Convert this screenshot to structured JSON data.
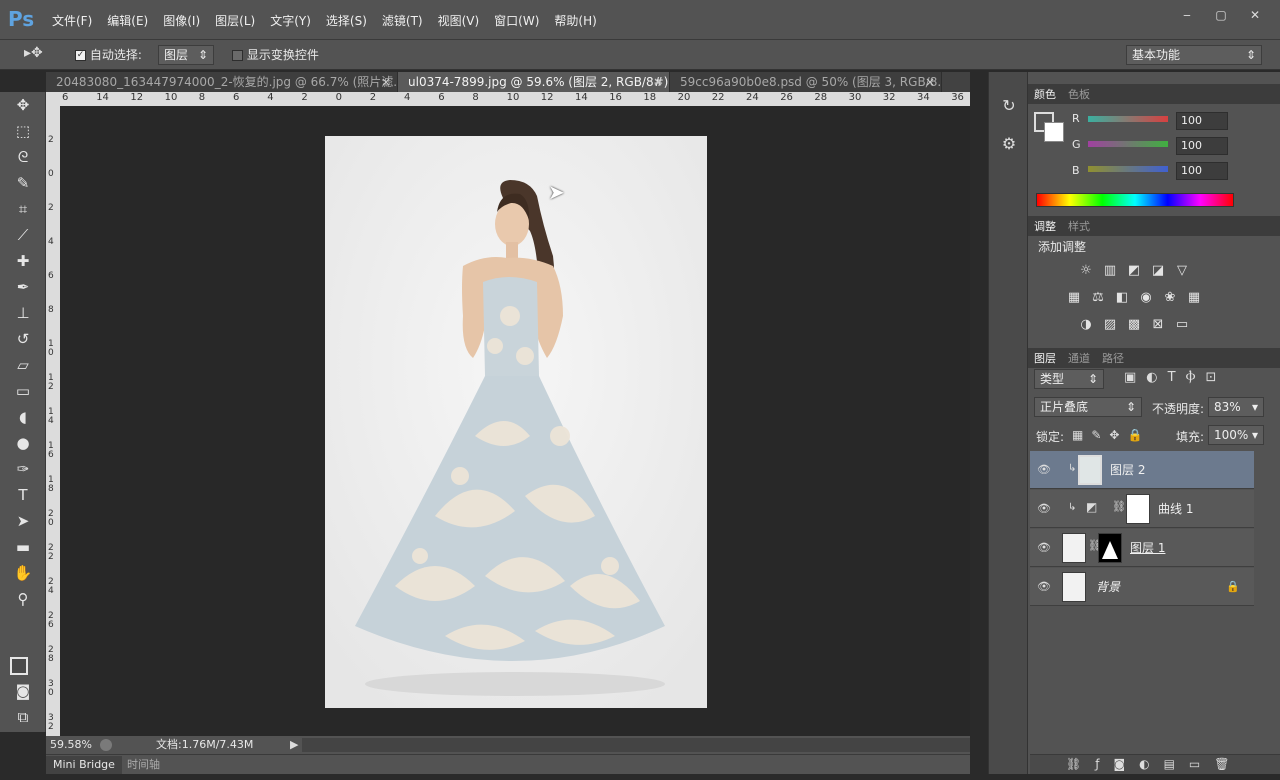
{
  "app": {
    "logo": "Ps",
    "menu": [
      "文件(F)",
      "编辑(E)",
      "图像(I)",
      "图层(L)",
      "文字(Y)",
      "选择(S)",
      "滤镜(T)",
      "视图(V)",
      "窗口(W)",
      "帮助(H)"
    ],
    "window_controls": [
      "‒",
      "▢",
      "✕"
    ]
  },
  "options": {
    "move_icon": "move-tool-icon",
    "auto_select_label": "自动选择:",
    "auto_select_checked": true,
    "auto_select_target": "图层",
    "show_transform_label": "显示变换控件",
    "show_transform_checked": false,
    "workspace": "基本功能"
  },
  "tabs": [
    {
      "label": "20483080_163447974000_2-恢复的.jpg @ 66.7% (照片滤...",
      "active": false
    },
    {
      "label": "ul0374-7899.jpg @ 59.6% (图层 2, RGB/8#) *",
      "active": true
    },
    {
      "label": "59cc96a90b0e8.psd @ 50% (图层 3, RGB/8...",
      "active": false
    }
  ],
  "ruler": {
    "top_labels": [
      "6",
      "14",
      "12",
      "10",
      "8",
      "6",
      "4",
      "2",
      "0",
      "2",
      "4",
      "6",
      "8",
      "10",
      "12",
      "14",
      "16",
      "18",
      "20",
      "22",
      "24",
      "26",
      "28",
      "30",
      "32",
      "34",
      "36"
    ],
    "left_labels": [
      "2",
      "0",
      "2",
      "4",
      "6",
      "8",
      "1 0",
      "1 2",
      "1 4",
      "1 6",
      "1 8",
      "2 0",
      "2 2",
      "2 4",
      "2 6",
      "2 8",
      "3 0",
      "3 2"
    ]
  },
  "status": {
    "zoom": "59.58%",
    "doc": "文档:1.76M/7.43M"
  },
  "bottom_tabs": [
    "Mini Bridge",
    "时间轴"
  ],
  "color_panel": {
    "tabs": [
      "颜色",
      "色板"
    ],
    "channels": [
      {
        "name": "R",
        "value": "100",
        "color": "#d84040"
      },
      {
        "name": "G",
        "value": "100",
        "color": "#40b040"
      },
      {
        "name": "B",
        "value": "100",
        "color": "#4060d0"
      }
    ]
  },
  "adjust_panel": {
    "tabs": [
      "调整",
      "样式"
    ],
    "title": "添加调整",
    "icons": [
      [
        "brightness-icon",
        "levels-icon",
        "curves-icon",
        "exposure-icon",
        "triangle-icon"
      ],
      [
        "vibrance-icon",
        "balance-icon",
        "bw-icon",
        "photo-filter-icon",
        "mixer-icon",
        "lookup-icon"
      ],
      [
        "invert-icon",
        "posterize-icon",
        "threshold-icon",
        "selective-icon",
        "gradient-map-icon"
      ]
    ]
  },
  "layers_panel": {
    "tabs": [
      "图层",
      "通道",
      "路径"
    ],
    "filter": "类型",
    "blend": "正片叠底",
    "opacity_label": "不透明度:",
    "opacity": "83%",
    "lock_label": "锁定:",
    "fill_label": "填充:",
    "fill": "100%",
    "layers": [
      {
        "name": "图层 2",
        "selected": true
      },
      {
        "name": "曲线 1",
        "selected": false
      },
      {
        "name": "图层 1",
        "selected": false
      },
      {
        "name": "背景",
        "selected": false
      }
    ]
  }
}
